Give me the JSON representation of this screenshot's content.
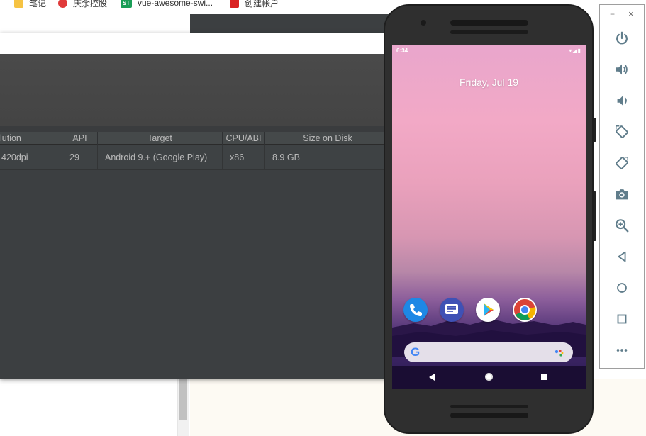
{
  "bookmarks": [
    {
      "label": "笔记",
      "icon": "folder-icon"
    },
    {
      "label": "庆余控股",
      "icon": "site-icon"
    },
    {
      "label": "vue-awesome-swi...",
      "icon": "st-badge-icon"
    },
    {
      "label": "创建帐户",
      "icon": "site-icon"
    }
  ],
  "st_badge": "ST",
  "avd": {
    "columns": [
      "lution",
      "API",
      "Target",
      "CPU/ABI",
      "Size on Disk"
    ],
    "rows": [
      {
        "resolution": "420dpi",
        "api": "29",
        "target": "Android 9.+ (Google Play)",
        "cpu": "x86",
        "size": "8.9 GB"
      }
    ]
  },
  "phone": {
    "status_time": "6:34",
    "status_icons": "▾◢▮",
    "date": "Friday, Jul 19",
    "dock_apps": [
      "phone-app-icon",
      "messages-app-icon",
      "play-store-icon",
      "chrome-icon"
    ],
    "search_logo": "G"
  },
  "toolbar": {
    "minimize": "−",
    "close": "×",
    "buttons": [
      "power-icon",
      "volume-up-icon",
      "volume-down-icon",
      "rotate-left-icon",
      "rotate-right-icon",
      "camera-icon",
      "zoom-icon",
      "back-icon",
      "home-icon",
      "overview-icon",
      "more-icon"
    ]
  },
  "colors": {
    "dialog_bg": "#3c3f41",
    "header_bg": "#4a4a4a",
    "toolbar_icon": "#607d8b",
    "screen_top": "#f2a9c6",
    "screen_bottom": "#2a1a52"
  }
}
